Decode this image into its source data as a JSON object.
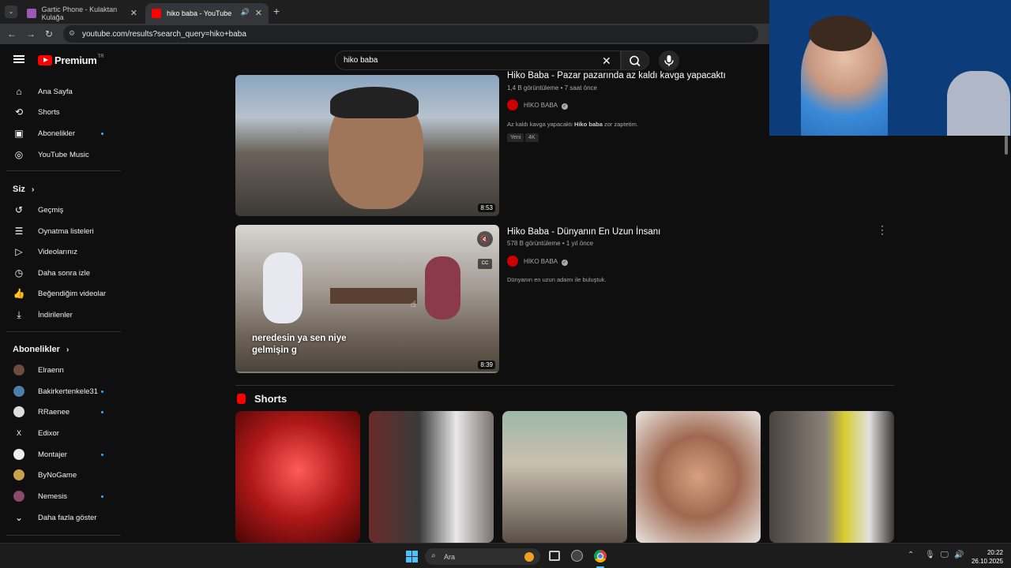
{
  "browser": {
    "tabs": [
      {
        "title": "Gartic Phone - Kulaktan Kulağa",
        "active": false
      },
      {
        "title": "hiko baba - YouTube",
        "active": true
      }
    ],
    "new_tab": "+",
    "url": "youtube.com/results?search_query=hiko+baba"
  },
  "youtube": {
    "logo_text": "Premium",
    "logo_region": "TR",
    "search_value": "hiko baba"
  },
  "sidebar": {
    "main": [
      {
        "label": "Ana Sayfa",
        "icon": "home-icon"
      },
      {
        "label": "Shorts",
        "icon": "shorts-icon"
      },
      {
        "label": "Abonelikler",
        "icon": "subscriptions-icon",
        "dot": true
      },
      {
        "label": "YouTube Music",
        "icon": "music-icon"
      }
    ],
    "you_header": "Siz",
    "you": [
      {
        "label": "Geçmiş",
        "icon": "history-icon"
      },
      {
        "label": "Oynatma listeleri",
        "icon": "playlist-icon"
      },
      {
        "label": "Videolarınız",
        "icon": "your-videos-icon"
      },
      {
        "label": "Daha sonra izle",
        "icon": "watch-later-icon"
      },
      {
        "label": "Beğendiğim videolar",
        "icon": "like-icon"
      },
      {
        "label": "İndirilenler",
        "icon": "download-icon"
      }
    ],
    "subs_header": "Abonelikler",
    "subs": [
      {
        "label": "Elraenn",
        "dot": false,
        "color": "#6b4b3a"
      },
      {
        "label": "Bakirkertenkele31",
        "dot": true,
        "color": "#4a7fa8"
      },
      {
        "label": "RRaenee",
        "dot": true,
        "color": "#dddddd"
      },
      {
        "label": "Edixor",
        "dot": false,
        "color": "#111111"
      },
      {
        "label": "Montajer",
        "dot": true,
        "color": "#eeeeee"
      },
      {
        "label": "ByNoGame",
        "dot": false,
        "color": "#c9a24a"
      },
      {
        "label": "Nemesis",
        "dot": true,
        "color": "#8a4a6a"
      }
    ],
    "show_more": "Daha fazla göster"
  },
  "results": [
    {
      "title": "Hiko Baba - Pazar pazarında az kaldı kavga yapacaktı",
      "views": "1,4 B görüntüleme",
      "age": "7 saat önce",
      "channel": "HİKO BABA",
      "desc_pre": "Az kaldı kavga yapacaktı ",
      "desc_bold": "Hiko baba",
      "desc_post": " zor zaptetim.",
      "badges": [
        "Yeni",
        "4K"
      ],
      "duration": "8:53"
    },
    {
      "title": "Hiko Baba - Dünyanın En Uzun İnsanı",
      "views": "578 B görüntüleme",
      "age": "1 yıl önce",
      "channel": "HİKO BABA",
      "desc": "Dünyanın en uzun adamı ile buluştuk.",
      "duration": "8:39",
      "caption_line1": "neredesin ya sen niye",
      "caption_line2": "gelmişin g"
    }
  ],
  "shorts_header": "Shorts",
  "taskbar": {
    "search_placeholder": "Ara",
    "time": "20:22",
    "date": "26.10.2025"
  }
}
